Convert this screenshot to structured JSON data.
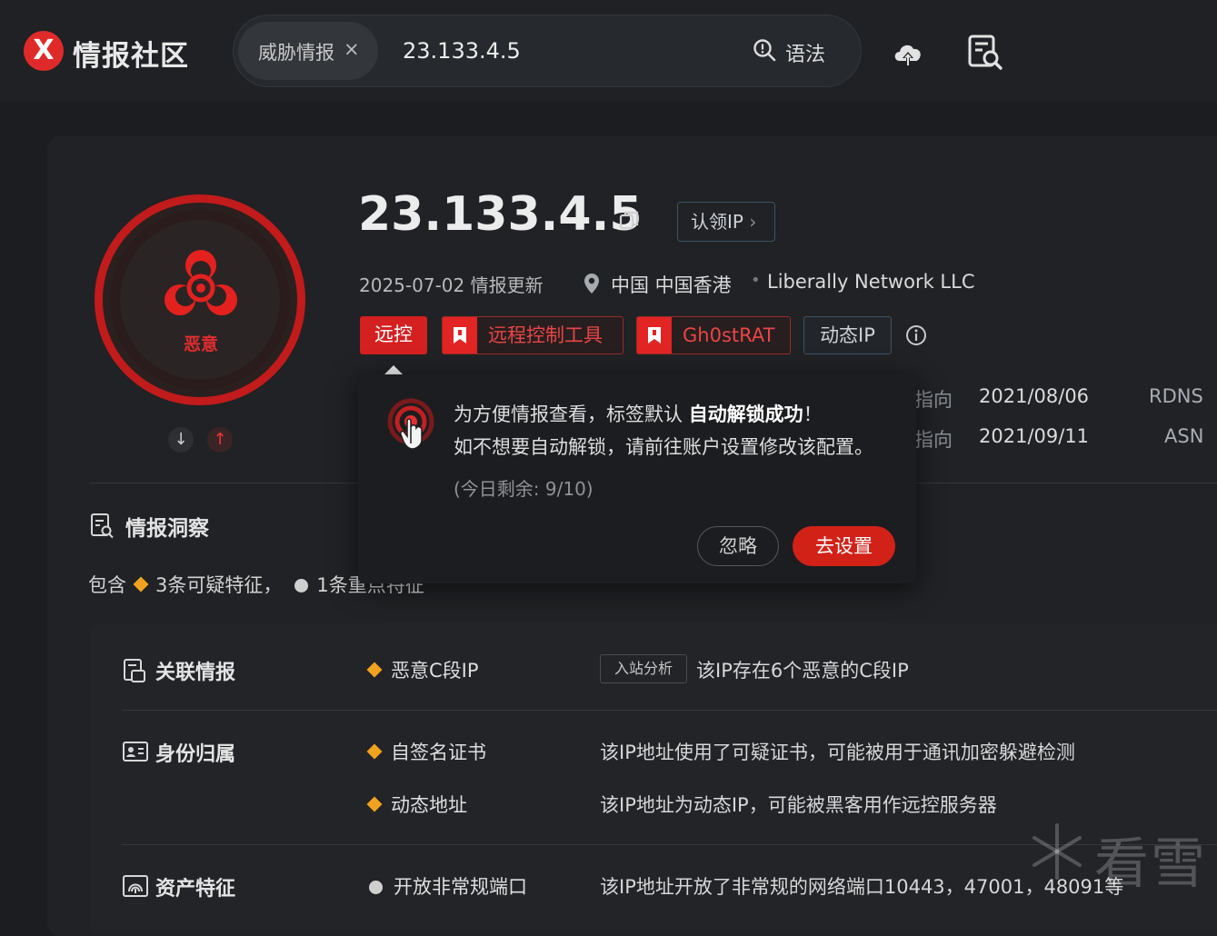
{
  "header": {
    "brand": "情报社区",
    "logo_letter": "X",
    "search_chip": {
      "label": "威胁情报",
      "close": "×"
    },
    "query": "23.133.4.5",
    "syntax_label": "语法",
    "icons": [
      "search-icon",
      "cloud-upload-icon",
      "report-search-icon"
    ]
  },
  "verdict": {
    "label": "恶意",
    "icon": "biohazard-icon",
    "color": "#e12d2d"
  },
  "ip": {
    "address": "23.133.4.5",
    "claim_label": "认领IP",
    "claim_chevron": "›",
    "update_date": "2025-07-02 情报更新",
    "location": "中国 中国香港",
    "separator": "•",
    "org": "Liberally Network LLC"
  },
  "tags": [
    "远控",
    "远程控制工具",
    "Gh0stRAT",
    "动态IP"
  ],
  "rows": [
    {
      "label": "指向",
      "date": "2021/08/06",
      "type": "RDNS"
    },
    {
      "label": "指向",
      "date": "2021/09/11",
      "type": "ASN"
    }
  ],
  "insight": {
    "title": "情报洞察",
    "contain_prefix": "包含",
    "suspicious": "3条可疑特征，",
    "key_features": "1条重点特征"
  },
  "sections": {
    "related": {
      "title": "关联情报",
      "feature": "恶意C段IP",
      "tag": "入站分析",
      "desc": "该IP存在6个恶意的C段IP"
    },
    "identity": {
      "title": "身份归属",
      "items": [
        {
          "feature": "自签名证书",
          "desc": "该IP地址使用了可疑证书，可能被用于通讯加密躲避检测"
        },
        {
          "feature": "动态地址",
          "desc": "该IP地址为动态IP，可能被黑客用作远控服务器"
        }
      ]
    },
    "assets": {
      "title": "资产特征",
      "feature": "开放非常规端口",
      "desc": "该IP地址开放了非常规的网络端口10443，47001，48091等"
    }
  },
  "popup": {
    "line1_prefix": "为方便情报查看，标签默认 ",
    "line1_bold": "自动解锁成功",
    "line1_suffix": "！",
    "line2": "如不想要自动解锁，请前往账户设置修改该配置。",
    "remaining": "(今日剩余: 9/10)",
    "ignore_label": "忽略",
    "go_label": "去设置"
  },
  "watermark": "看雪",
  "colors": {
    "accent_red": "#d42020",
    "warn_orange": "#f2a21f",
    "bg": "#1b1d20"
  }
}
